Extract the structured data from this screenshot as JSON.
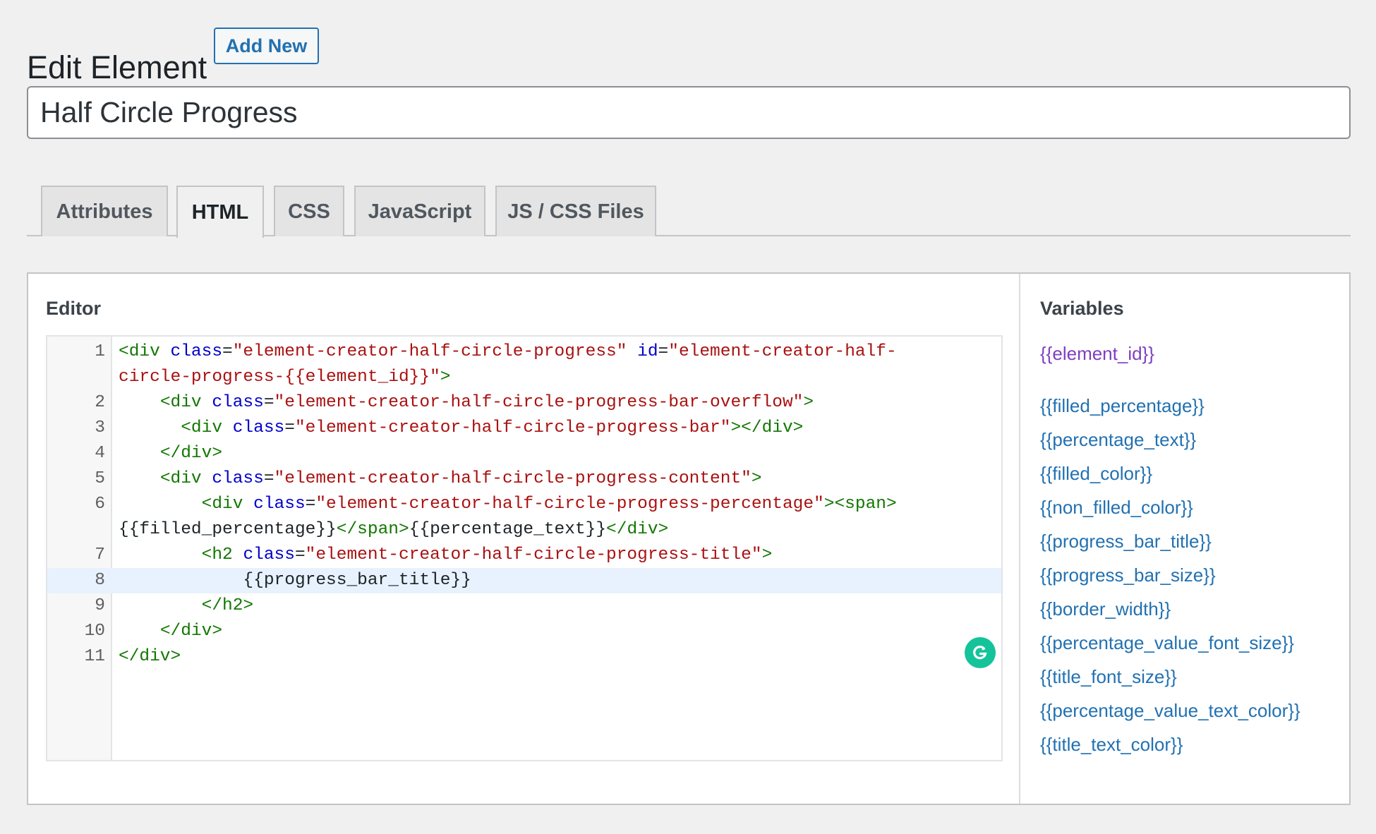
{
  "header": {
    "title": "Edit Element",
    "add_new_label": "Add New"
  },
  "element_title": {
    "value": "Half Circle Progress"
  },
  "tabs": [
    {
      "label": "Attributes",
      "active": false
    },
    {
      "label": "HTML",
      "active": true
    },
    {
      "label": "CSS",
      "active": false
    },
    {
      "label": "JavaScript",
      "active": false
    },
    {
      "label": "JS / CSS Files",
      "active": false
    }
  ],
  "editor": {
    "heading": "Editor",
    "active_line": 8,
    "lines": [
      {
        "no": "1",
        "wrap": false,
        "tokens": [
          [
            "tg",
            "<div"
          ],
          [
            "tx",
            " "
          ],
          [
            "at",
            "class"
          ],
          [
            "tx",
            "="
          ],
          [
            "st",
            "\"element-creator-half-circle-progress\""
          ],
          [
            "tx",
            " "
          ],
          [
            "at",
            "id"
          ],
          [
            "tx",
            "="
          ],
          [
            "st",
            "\"element-creator-half-"
          ]
        ]
      },
      {
        "no": "",
        "wrap": true,
        "tokens": [
          [
            "st",
            "circle-progress-{{element_id}}\""
          ],
          [
            "tg",
            ">"
          ]
        ]
      },
      {
        "no": "2",
        "wrap": false,
        "tokens": [
          [
            "tx",
            "    "
          ],
          [
            "tg",
            "<div"
          ],
          [
            "tx",
            " "
          ],
          [
            "at",
            "class"
          ],
          [
            "tx",
            "="
          ],
          [
            "st",
            "\"element-creator-half-circle-progress-bar-overflow\""
          ],
          [
            "tg",
            ">"
          ]
        ]
      },
      {
        "no": "3",
        "wrap": false,
        "tokens": [
          [
            "tx",
            "      "
          ],
          [
            "tg",
            "<div"
          ],
          [
            "tx",
            " "
          ],
          [
            "at",
            "class"
          ],
          [
            "tx",
            "="
          ],
          [
            "st",
            "\"element-creator-half-circle-progress-bar\""
          ],
          [
            "tg",
            "></div>"
          ]
        ]
      },
      {
        "no": "4",
        "wrap": false,
        "tokens": [
          [
            "tx",
            "    "
          ],
          [
            "tg",
            "</div>"
          ]
        ]
      },
      {
        "no": "5",
        "wrap": false,
        "tokens": [
          [
            "tx",
            "    "
          ],
          [
            "tg",
            "<div"
          ],
          [
            "tx",
            " "
          ],
          [
            "at",
            "class"
          ],
          [
            "tx",
            "="
          ],
          [
            "st",
            "\"element-creator-half-circle-progress-content\""
          ],
          [
            "tg",
            ">"
          ]
        ]
      },
      {
        "no": "6",
        "wrap": false,
        "tokens": [
          [
            "tx",
            "        "
          ],
          [
            "tg",
            "<div"
          ],
          [
            "tx",
            " "
          ],
          [
            "at",
            "class"
          ],
          [
            "tx",
            "="
          ],
          [
            "st",
            "\"element-creator-half-circle-progress-percentage\""
          ],
          [
            "tg",
            "><span>"
          ]
        ]
      },
      {
        "no": "",
        "wrap": true,
        "tokens": [
          [
            "tx",
            "{{filled_percentage}}"
          ],
          [
            "tg",
            "</span>"
          ],
          [
            "tx",
            "{{percentage_text}}"
          ],
          [
            "tg",
            "</div>"
          ]
        ]
      },
      {
        "no": "7",
        "wrap": false,
        "tokens": [
          [
            "tx",
            "        "
          ],
          [
            "tg",
            "<h2"
          ],
          [
            "tx",
            " "
          ],
          [
            "at",
            "class"
          ],
          [
            "tx",
            "="
          ],
          [
            "st",
            "\"element-creator-half-circle-progress-title\""
          ],
          [
            "tg",
            ">"
          ]
        ]
      },
      {
        "no": "8",
        "wrap": false,
        "tokens": [
          [
            "tx",
            "            {{progress_bar_title}}"
          ]
        ]
      },
      {
        "no": "9",
        "wrap": false,
        "tokens": [
          [
            "tx",
            "        "
          ],
          [
            "tg",
            "</h2>"
          ]
        ]
      },
      {
        "no": "10",
        "wrap": false,
        "tokens": [
          [
            "tx",
            "    "
          ],
          [
            "tg",
            "</div>"
          ]
        ]
      },
      {
        "no": "11",
        "wrap": false,
        "tokens": [
          [
            "tg",
            "</div>"
          ]
        ]
      }
    ],
    "syntax_colors": {
      "tag": "#117700",
      "attribute": "#0000cc",
      "string": "#aa1111",
      "text": "#1d2327"
    },
    "grammarly_icon": "grammarly-g-icon"
  },
  "variables": {
    "heading": "Variables",
    "items": [
      {
        "label": "{{element_id}}",
        "visited": true
      },
      {
        "label": "{{filled_percentage}}",
        "visited": false
      },
      {
        "label": "{{percentage_text}}",
        "visited": false
      },
      {
        "label": "{{filled_color}}",
        "visited": false
      },
      {
        "label": "{{non_filled_color}}",
        "visited": false
      },
      {
        "label": "{{progress_bar_title}}",
        "visited": false
      },
      {
        "label": "{{progress_bar_size}}",
        "visited": false
      },
      {
        "label": "{{border_width}}",
        "visited": false
      },
      {
        "label": "{{percentage_value_font_size}}",
        "visited": false
      },
      {
        "label": "{{title_font_size}}",
        "visited": false
      },
      {
        "label": "{{percentage_value_text_color}}",
        "visited": false
      },
      {
        "label": "{{title_text_color}}",
        "visited": false
      }
    ]
  },
  "colors": {
    "link": "#2271b1",
    "visited_link": "#7e3ec2",
    "active_line_bg": "#e8f2fe"
  }
}
